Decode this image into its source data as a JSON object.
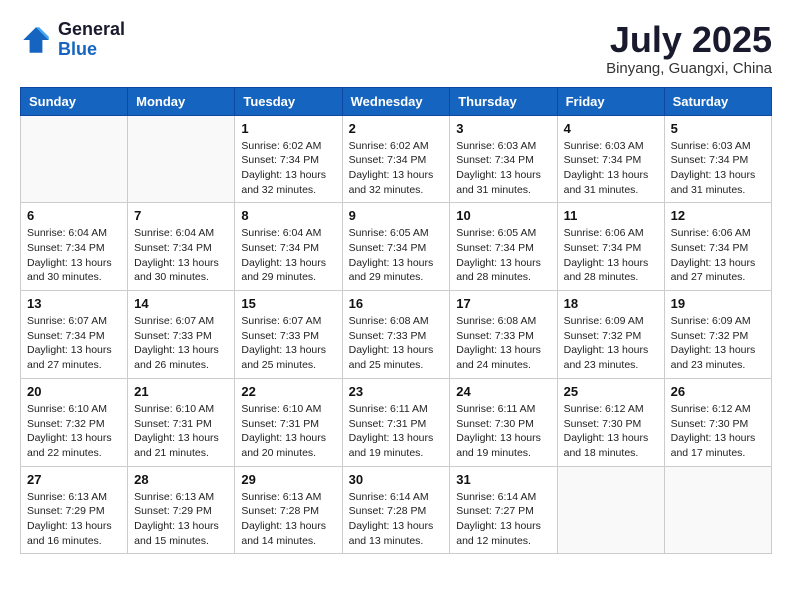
{
  "header": {
    "logo_general": "General",
    "logo_blue": "Blue",
    "month_title": "July 2025",
    "location": "Binyang, Guangxi, China"
  },
  "weekdays": [
    "Sunday",
    "Monday",
    "Tuesday",
    "Wednesday",
    "Thursday",
    "Friday",
    "Saturday"
  ],
  "weeks": [
    [
      {
        "day": "",
        "info": ""
      },
      {
        "day": "",
        "info": ""
      },
      {
        "day": "1",
        "info": "Sunrise: 6:02 AM\nSunset: 7:34 PM\nDaylight: 13 hours and 32 minutes."
      },
      {
        "day": "2",
        "info": "Sunrise: 6:02 AM\nSunset: 7:34 PM\nDaylight: 13 hours and 32 minutes."
      },
      {
        "day": "3",
        "info": "Sunrise: 6:03 AM\nSunset: 7:34 PM\nDaylight: 13 hours and 31 minutes."
      },
      {
        "day": "4",
        "info": "Sunrise: 6:03 AM\nSunset: 7:34 PM\nDaylight: 13 hours and 31 minutes."
      },
      {
        "day": "5",
        "info": "Sunrise: 6:03 AM\nSunset: 7:34 PM\nDaylight: 13 hours and 31 minutes."
      }
    ],
    [
      {
        "day": "6",
        "info": "Sunrise: 6:04 AM\nSunset: 7:34 PM\nDaylight: 13 hours and 30 minutes."
      },
      {
        "day": "7",
        "info": "Sunrise: 6:04 AM\nSunset: 7:34 PM\nDaylight: 13 hours and 30 minutes."
      },
      {
        "day": "8",
        "info": "Sunrise: 6:04 AM\nSunset: 7:34 PM\nDaylight: 13 hours and 29 minutes."
      },
      {
        "day": "9",
        "info": "Sunrise: 6:05 AM\nSunset: 7:34 PM\nDaylight: 13 hours and 29 minutes."
      },
      {
        "day": "10",
        "info": "Sunrise: 6:05 AM\nSunset: 7:34 PM\nDaylight: 13 hours and 28 minutes."
      },
      {
        "day": "11",
        "info": "Sunrise: 6:06 AM\nSunset: 7:34 PM\nDaylight: 13 hours and 28 minutes."
      },
      {
        "day": "12",
        "info": "Sunrise: 6:06 AM\nSunset: 7:34 PM\nDaylight: 13 hours and 27 minutes."
      }
    ],
    [
      {
        "day": "13",
        "info": "Sunrise: 6:07 AM\nSunset: 7:34 PM\nDaylight: 13 hours and 27 minutes."
      },
      {
        "day": "14",
        "info": "Sunrise: 6:07 AM\nSunset: 7:33 PM\nDaylight: 13 hours and 26 minutes."
      },
      {
        "day": "15",
        "info": "Sunrise: 6:07 AM\nSunset: 7:33 PM\nDaylight: 13 hours and 25 minutes."
      },
      {
        "day": "16",
        "info": "Sunrise: 6:08 AM\nSunset: 7:33 PM\nDaylight: 13 hours and 25 minutes."
      },
      {
        "day": "17",
        "info": "Sunrise: 6:08 AM\nSunset: 7:33 PM\nDaylight: 13 hours and 24 minutes."
      },
      {
        "day": "18",
        "info": "Sunrise: 6:09 AM\nSunset: 7:32 PM\nDaylight: 13 hours and 23 minutes."
      },
      {
        "day": "19",
        "info": "Sunrise: 6:09 AM\nSunset: 7:32 PM\nDaylight: 13 hours and 23 minutes."
      }
    ],
    [
      {
        "day": "20",
        "info": "Sunrise: 6:10 AM\nSunset: 7:32 PM\nDaylight: 13 hours and 22 minutes."
      },
      {
        "day": "21",
        "info": "Sunrise: 6:10 AM\nSunset: 7:31 PM\nDaylight: 13 hours and 21 minutes."
      },
      {
        "day": "22",
        "info": "Sunrise: 6:10 AM\nSunset: 7:31 PM\nDaylight: 13 hours and 20 minutes."
      },
      {
        "day": "23",
        "info": "Sunrise: 6:11 AM\nSunset: 7:31 PM\nDaylight: 13 hours and 19 minutes."
      },
      {
        "day": "24",
        "info": "Sunrise: 6:11 AM\nSunset: 7:30 PM\nDaylight: 13 hours and 19 minutes."
      },
      {
        "day": "25",
        "info": "Sunrise: 6:12 AM\nSunset: 7:30 PM\nDaylight: 13 hours and 18 minutes."
      },
      {
        "day": "26",
        "info": "Sunrise: 6:12 AM\nSunset: 7:30 PM\nDaylight: 13 hours and 17 minutes."
      }
    ],
    [
      {
        "day": "27",
        "info": "Sunrise: 6:13 AM\nSunset: 7:29 PM\nDaylight: 13 hours and 16 minutes."
      },
      {
        "day": "28",
        "info": "Sunrise: 6:13 AM\nSunset: 7:29 PM\nDaylight: 13 hours and 15 minutes."
      },
      {
        "day": "29",
        "info": "Sunrise: 6:13 AM\nSunset: 7:28 PM\nDaylight: 13 hours and 14 minutes."
      },
      {
        "day": "30",
        "info": "Sunrise: 6:14 AM\nSunset: 7:28 PM\nDaylight: 13 hours and 13 minutes."
      },
      {
        "day": "31",
        "info": "Sunrise: 6:14 AM\nSunset: 7:27 PM\nDaylight: 13 hours and 12 minutes."
      },
      {
        "day": "",
        "info": ""
      },
      {
        "day": "",
        "info": ""
      }
    ]
  ]
}
